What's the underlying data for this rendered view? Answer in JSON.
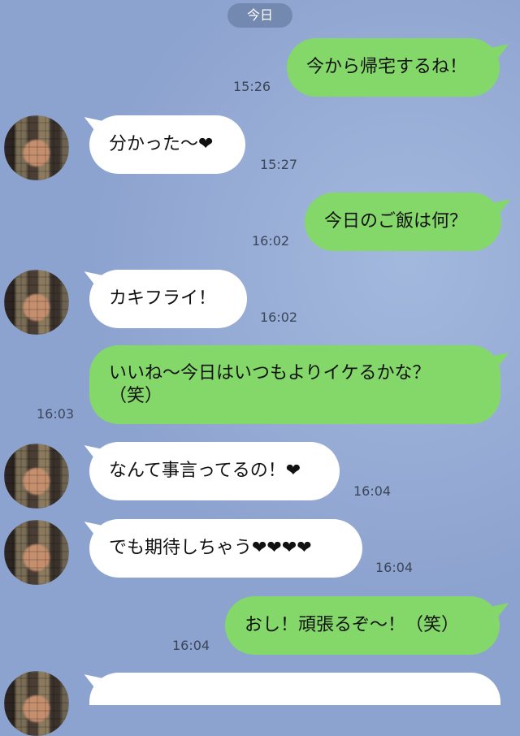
{
  "chat": {
    "date_label": "今日",
    "messages": [
      {
        "text": "今から帰宅するね！",
        "time": "15:26"
      },
      {
        "text": "分かった〜❤",
        "time": "15:27"
      },
      {
        "text": "今日のご飯は何？",
        "time": "16:02"
      },
      {
        "text": "カキフライ！",
        "time": "16:02"
      },
      {
        "line1": "いいね〜今日はいつもよりイケるかな？",
        "line2": "（笑）",
        "time": "16:03"
      },
      {
        "text": "なんて事言ってるの！❤",
        "time": "16:04"
      },
      {
        "text": "でも期待しちゃう❤❤❤❤",
        "time": "16:04"
      },
      {
        "text": "おし！頑張るぞ〜！（笑）",
        "time": "16:04"
      }
    ]
  },
  "colors": {
    "background": "#8da3cf",
    "outgoing_bubble": "#84d86a",
    "incoming_bubble": "#ffffff",
    "date_pill": "#7489b0",
    "timestamp": "#3b4558"
  },
  "icons": {
    "avatar": "pixelated-profile-photo"
  }
}
